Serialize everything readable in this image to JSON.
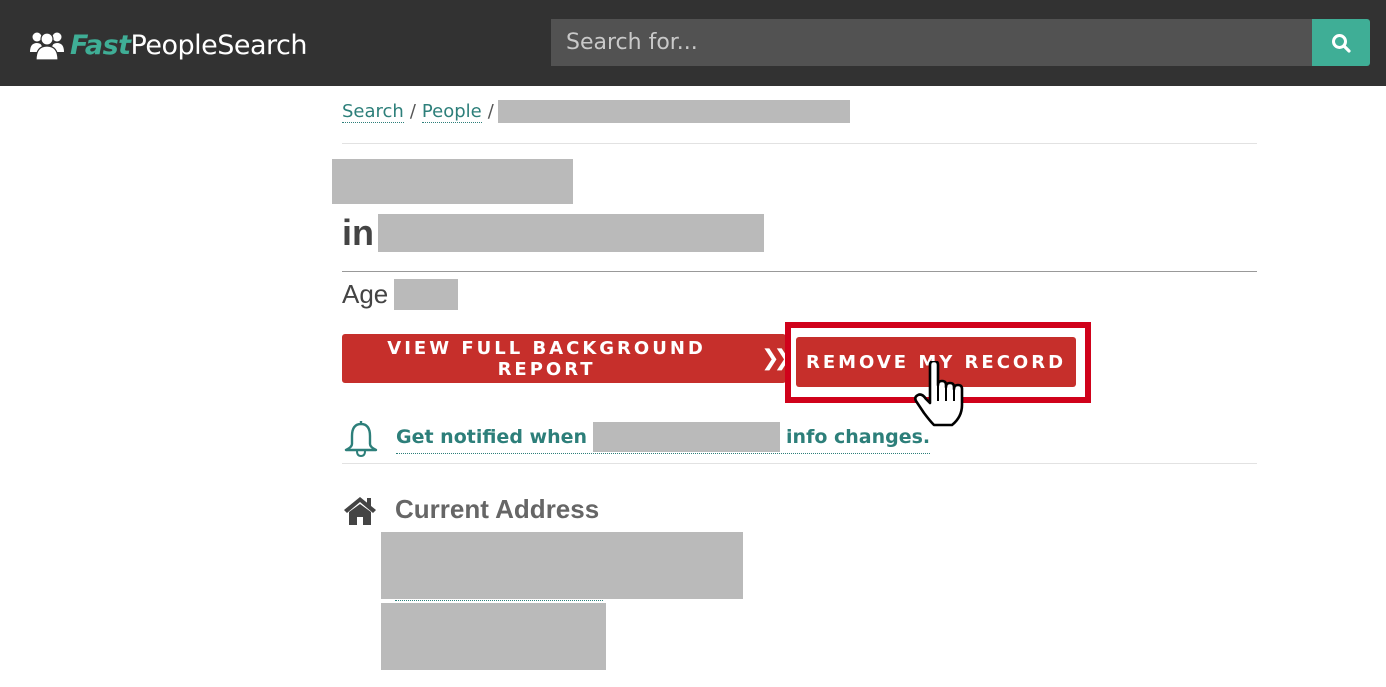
{
  "header": {
    "logo": {
      "fast": "Fast",
      "rest": "PeopleSearch",
      "icon": "people-group-icon"
    },
    "search": {
      "placeholder": "Search for...",
      "value": "",
      "button_icon": "search-icon"
    },
    "colors": {
      "bar": "#323232",
      "accent": "#3fae96",
      "input_bg": "#525252"
    }
  },
  "breadcrumb": {
    "items": [
      {
        "label": "Search"
      },
      {
        "label": "People"
      }
    ],
    "separator": "/",
    "current": "[redacted]"
  },
  "profile": {
    "name": "[redacted]",
    "location_prefix": "in",
    "location": "[redacted]",
    "age_label": "Age",
    "age": "[redacted]"
  },
  "actions": {
    "report_button": "VIEW FULL BACKGROUND REPORT",
    "report_icon": "double-chevron-right-icon",
    "remove_button": "REMOVE MY RECORD",
    "highlight_color": "#d0021b",
    "button_color": "#c62f2b"
  },
  "notify": {
    "icon": "bell-icon",
    "prefix": "Get notified when",
    "name": "[redacted]",
    "suffix": "info changes."
  },
  "address": {
    "icon": "home-icon",
    "title": "Current Address",
    "lines": [
      "[redacted]",
      "[redacted]"
    ]
  },
  "colors": {
    "link": "#2d7f7a",
    "redaction": "#bababa"
  }
}
